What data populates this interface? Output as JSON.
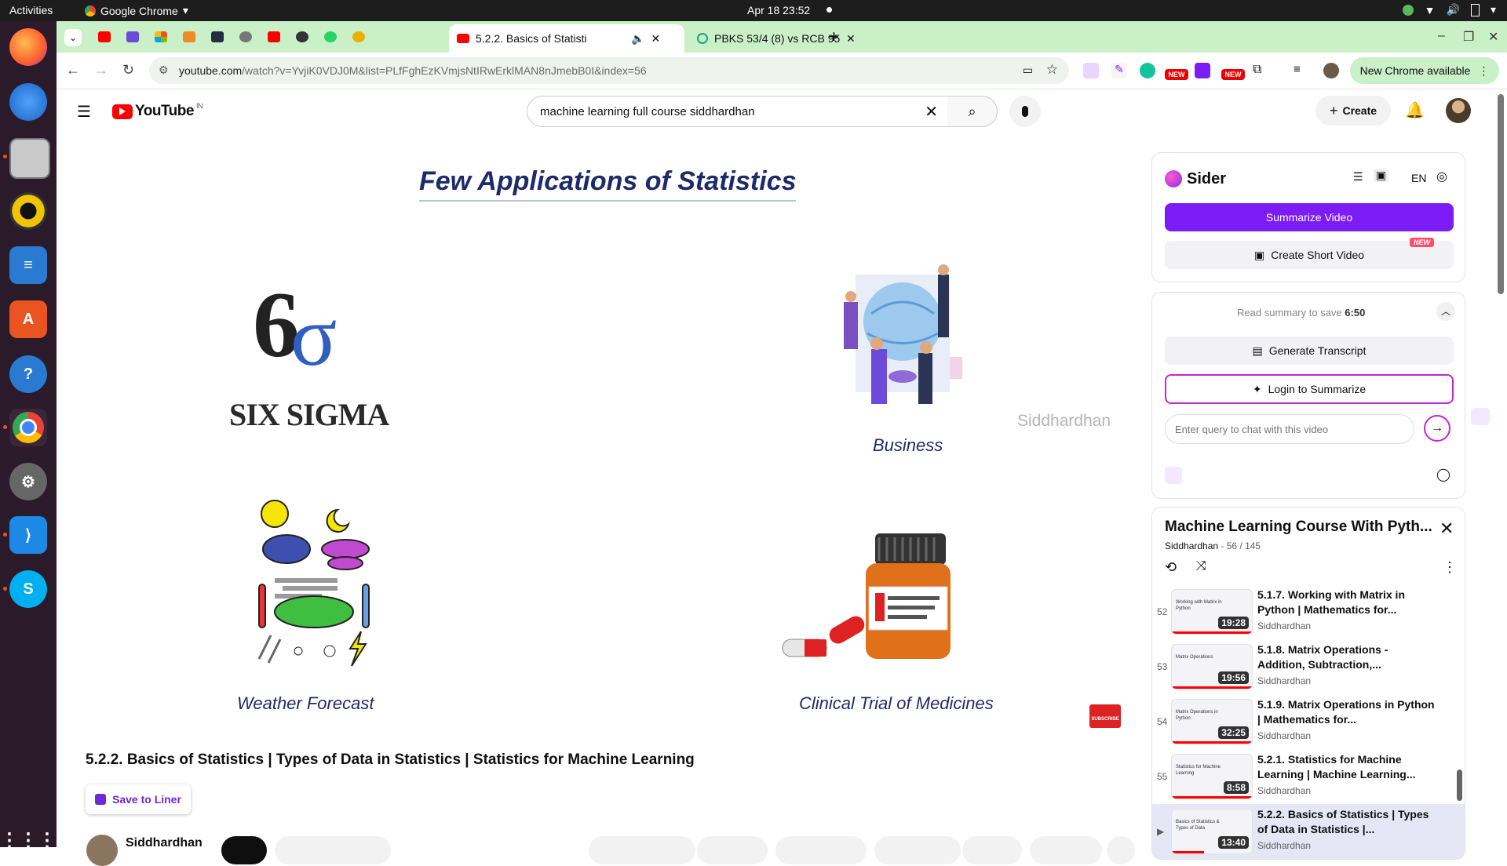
{
  "os_bar": {
    "activities": "Activities",
    "app": "Google Chrome",
    "clock": "Apr 18  23:52"
  },
  "tabs": {
    "active_title": "5.2.2. Basics of Statisti",
    "other_title": "PBKS 53/4 (8) vs RCB 95/"
  },
  "address_bar": {
    "domain": "youtube.com",
    "path": "/watch?v=YvjiK0VDJ0M&list=PLfFghEzKVmjsNtIRwErklMAN8nJmebB0I&index=56"
  },
  "new_chrome": "New Chrome available",
  "new_badge": "NEW",
  "youtube": {
    "logo_text": "YouTube",
    "region": "IN",
    "search_query": "machine learning full course siddhardhan",
    "create_label": "Create"
  },
  "slide": {
    "title": "Few Applications of Statistics",
    "sixsigma_label": "SIX SIGMA",
    "sixsigma_digit": "6",
    "sixsigma_sigma": "σ",
    "business_caption": "Business",
    "weather_caption": "Weather Forecast",
    "clinical_caption": "Clinical Trial of Medicines",
    "watermark": "Siddhardhan",
    "subscribe": "SUBSCRIBE"
  },
  "video": {
    "title": "5.2.2. Basics of Statistics | Types of Data in Statistics | Statistics for Machine Learning",
    "save_to_liner": "Save to Liner",
    "channel": "Siddhardhan"
  },
  "sider": {
    "brand": "Sider",
    "lang": "EN",
    "summarize_video": "Summarize Video",
    "create_short_video": "Create Short Video",
    "new_badge": "NEW",
    "read_summary_prefix": "Read summary to save ",
    "read_summary_time": "6:50",
    "generate_transcript": "Generate Transcript",
    "login_to_summarize": "Login to Summarize",
    "chat_placeholder": "Enter query to chat with this video"
  },
  "playlist": {
    "title": "Machine Learning Course With Pyth...",
    "channel": "Siddhardhan",
    "position": " - 56 / 145",
    "items": [
      {
        "num": "52",
        "title": "5.1.7. Working with Matrix in Python | Mathematics for...",
        "channel": "Siddhardhan",
        "duration": "19:28",
        "thumb": "Working with Matrix in Python"
      },
      {
        "num": "53",
        "title": "5.1.8. Matrix Operations - Addition, Subtraction,...",
        "channel": "Siddhardhan",
        "duration": "19:56",
        "thumb": "Matrix Operations"
      },
      {
        "num": "54",
        "title": "5.1.9. Matrix Operations in Python | Mathematics for...",
        "channel": "Siddhardhan",
        "duration": "32:25",
        "thumb": "Matrix Operations in Python"
      },
      {
        "num": "55",
        "title": "5.2.1. Statistics for Machine Learning | Machine Learning...",
        "channel": "Siddhardhan",
        "duration": "8:58",
        "thumb": "Statistics for Machine Learning"
      },
      {
        "num": "▶",
        "title": "5.2.2. Basics of Statistics | Types of Data in Statistics |...",
        "channel": "Siddhardhan",
        "duration": "13:40",
        "thumb": "Basics of Statistics & Types of Data"
      }
    ]
  },
  "colors": {
    "youtube_red": "#ff0000",
    "sider_purple": "#7b1bf5",
    "tab_green": "#c9f0c7",
    "slide_navy": "#1f2a6b"
  }
}
